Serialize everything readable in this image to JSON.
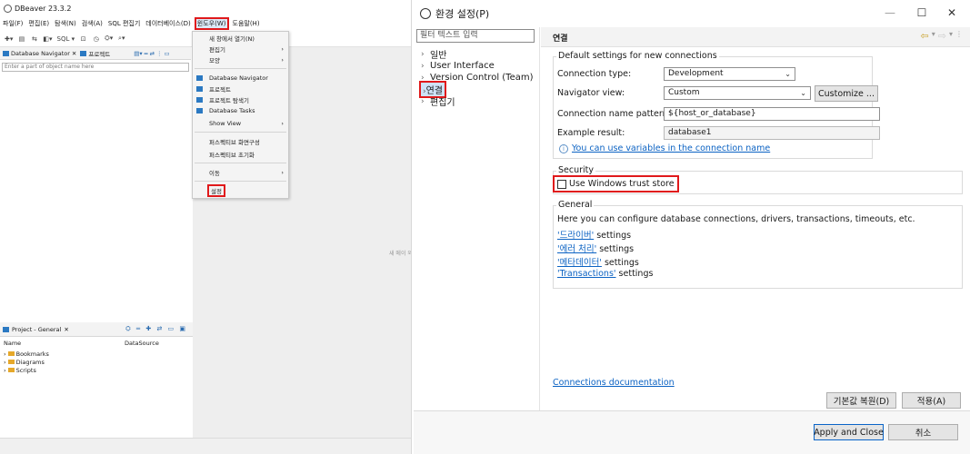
{
  "left": {
    "title": "DBeaver 23.3.2",
    "menu": [
      "파일(F)",
      "편집(E)",
      "탐색(N)",
      "검색(A)",
      "SQL 편집기",
      "데이터베이스(D)",
      "윈도우(W)",
      "도움말(H)"
    ],
    "toolbar": {
      "sql_label": "SQL"
    },
    "tabs": {
      "db_nav": "Database Navigator",
      "project": "프로젝트"
    },
    "filter_placeholder": "Enter a part of object name here",
    "editor_hint": "새 메이 와",
    "window_menu": {
      "items": [
        "새 창에서 열기(N)",
        "편집기",
        "모양",
        "Database Navigator",
        "프로젝트",
        "프로젝트 탐색기",
        "Database Tasks",
        "Show View",
        "퍼스펙티브 화면구성",
        "퍼스펙티브 초기화",
        "이동",
        "설정"
      ]
    },
    "project_panel": {
      "tab": "Project - General",
      "col_name": "Name",
      "col_source": "DataSource",
      "rows": [
        "Bookmarks",
        "Diagrams",
        "Scripts"
      ]
    }
  },
  "pref": {
    "title": "환경 설정(P)",
    "filter_placeholder": "필터 텍스트 입력",
    "tree": [
      "일반",
      "User Interface",
      "Version Control (Team)",
      "연결",
      "편집기"
    ],
    "page_title": "연결",
    "defaults_group": "Default settings for new connections",
    "connection_type_label": "Connection type:",
    "connection_type_value": "Development",
    "navigator_view_label": "Navigator view:",
    "navigator_view_value": "Custom",
    "customize_button": "Customize ...",
    "name_pattern_label": "Connection name pattern:",
    "name_pattern_value": "${host_or_database}",
    "example_label": "Example result:",
    "example_value": "database1",
    "variables_link": "You can use variables in the connection name",
    "security_group": "Security",
    "trust_store_label": "Use Windows trust store",
    "general_group": "General",
    "general_text": "Here you can configure database connections, drivers, transactions, timeouts, etc.",
    "settings_links": [
      {
        "link": "'드라이버'",
        "suffix": " settings"
      },
      {
        "link": "'에러 처리'",
        "suffix": " settings"
      },
      {
        "link": "'메타데이터'",
        "suffix": " settings"
      },
      {
        "link": "'Transactions'",
        "suffix": " settings"
      }
    ],
    "docs_link": "Connections documentation",
    "restore_defaults": "기본값 복원(D)",
    "apply": "적용(A)",
    "apply_close": "Apply and Close",
    "cancel": "취소"
  },
  "colors": {
    "accent": "#0b62c3",
    "highlight_box": "#e0191b"
  }
}
